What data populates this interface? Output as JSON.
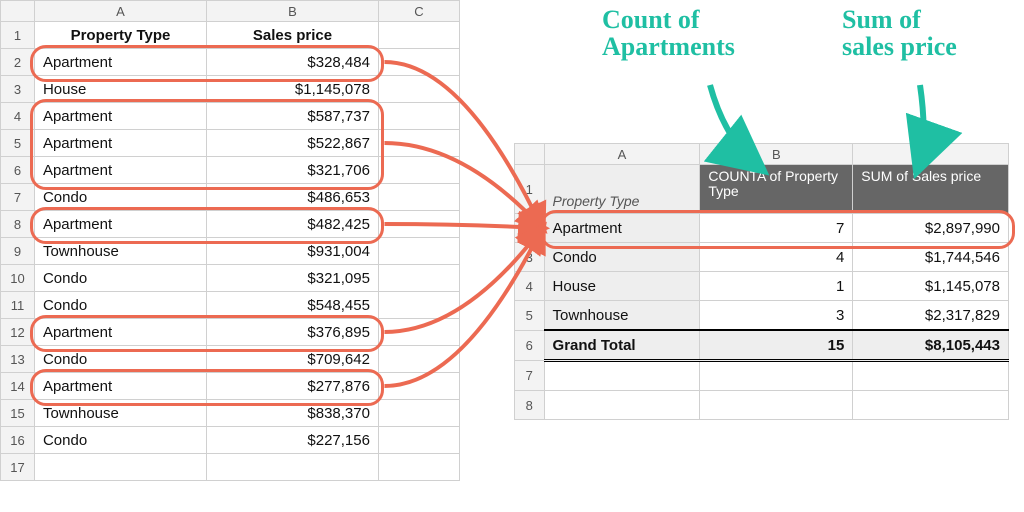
{
  "source": {
    "col_labels": {
      "a": "A",
      "b": "B",
      "c": "C"
    },
    "headers": {
      "property_type": "Property Type",
      "sales_price": "Sales price"
    },
    "rows": [
      {
        "type": "Apartment",
        "price": "$328,484",
        "highlight": true
      },
      {
        "type": "House",
        "price": "$1,145,078",
        "highlight": false
      },
      {
        "type": "Apartment",
        "price": "$587,737",
        "highlight": true
      },
      {
        "type": "Apartment",
        "price": "$522,867",
        "highlight": true
      },
      {
        "type": "Apartment",
        "price": "$321,706",
        "highlight": true
      },
      {
        "type": "Condo",
        "price": "$486,653",
        "highlight": false
      },
      {
        "type": "Apartment",
        "price": "$482,425",
        "highlight": true
      },
      {
        "type": "Townhouse",
        "price": "$931,004",
        "highlight": false
      },
      {
        "type": "Condo",
        "price": "$321,095",
        "highlight": false
      },
      {
        "type": "Condo",
        "price": "$548,455",
        "highlight": false
      },
      {
        "type": "Apartment",
        "price": "$376,895",
        "highlight": true
      },
      {
        "type": "Condo",
        "price": "$709,642",
        "highlight": false
      },
      {
        "type": "Apartment",
        "price": "$277,876",
        "highlight": true
      },
      {
        "type": "Townhouse",
        "price": "$838,370",
        "highlight": false
      },
      {
        "type": "Condo",
        "price": "$227,156",
        "highlight": false
      }
    ],
    "blank_row": "17"
  },
  "pivot": {
    "col_labels": {
      "a": "A",
      "b": "B",
      "c": "C"
    },
    "headers": {
      "property_type": "Property Type",
      "count": "COUNTA of Property Type",
      "sum": "SUM of Sales price"
    },
    "rows": [
      {
        "type": "Apartment",
        "count": "7",
        "sum": "$2,897,990",
        "highlight": true
      },
      {
        "type": "Condo",
        "count": "4",
        "sum": "$1,744,546",
        "highlight": false
      },
      {
        "type": "House",
        "count": "1",
        "sum": "$1,145,078",
        "highlight": false
      },
      {
        "type": "Townhouse",
        "count": "3",
        "sum": "$2,317,829",
        "highlight": false
      }
    ],
    "total": {
      "label": "Grand Total",
      "count": "15",
      "sum": "$8,105,443"
    },
    "blank_rows": [
      "7",
      "8"
    ]
  },
  "annotations": {
    "count_label": "Count of\nApartments",
    "sum_label": "Sum of\nsales price",
    "colors": {
      "ring": "#ec6a52",
      "arrow_red": "#ec6a52",
      "arrow_teal": "#1fbfa3"
    }
  }
}
